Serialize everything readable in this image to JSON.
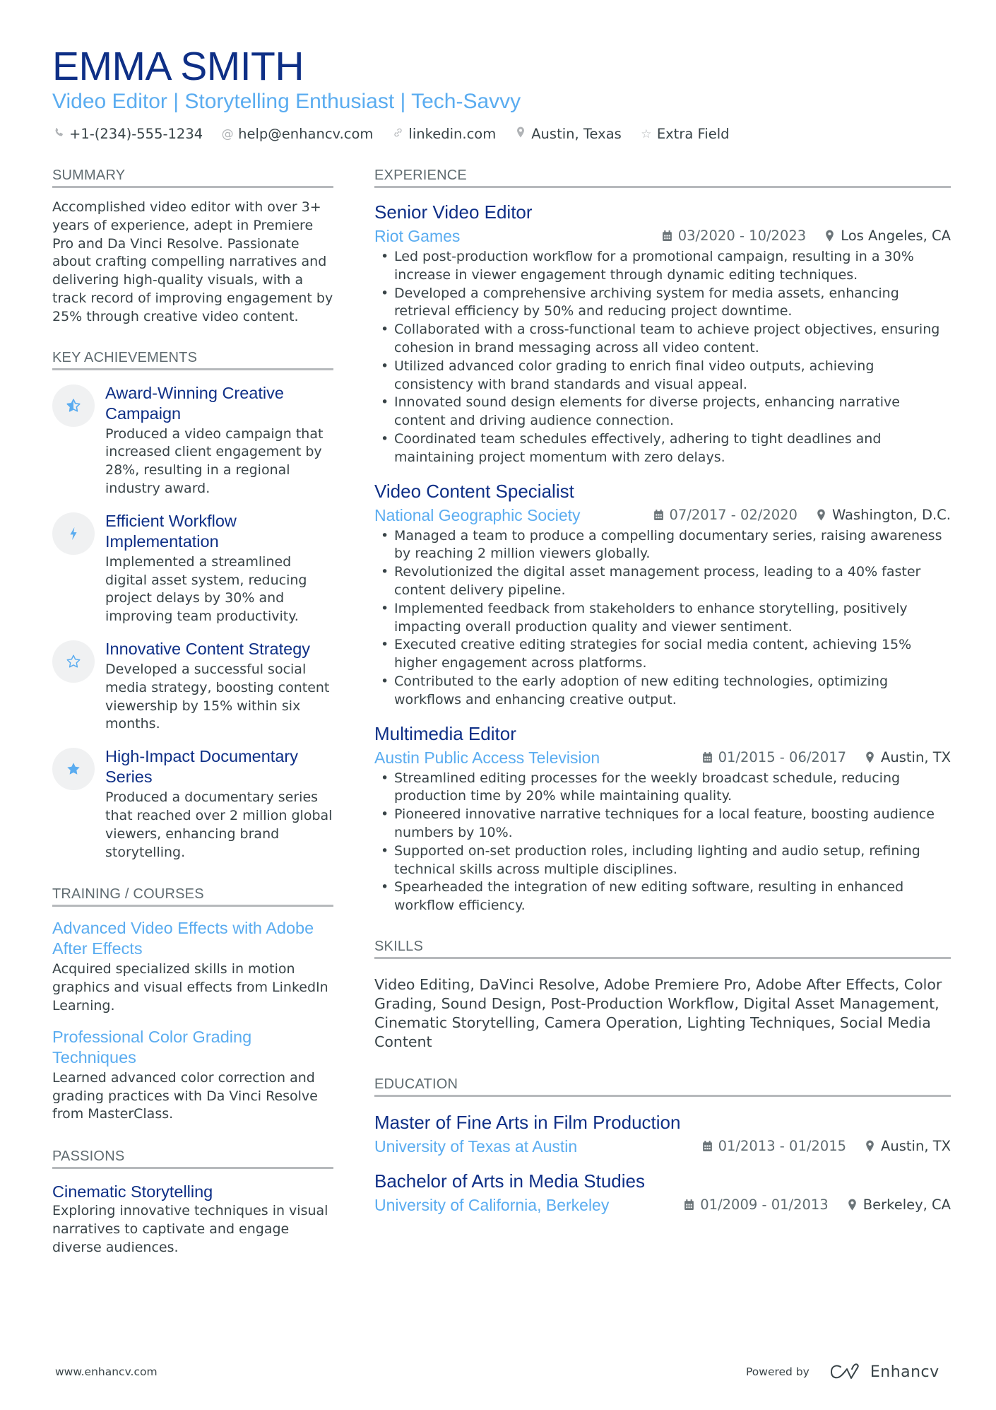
{
  "header": {
    "name": "EMMA SMITH",
    "subtitle": "Video Editor | Storytelling Enthusiast | Tech-Savvy",
    "contacts": [
      {
        "icon": "phone-icon",
        "text": "+1-(234)-555-1234"
      },
      {
        "icon": "at-icon",
        "text": "help@enhancv.com"
      },
      {
        "icon": "link-icon",
        "text": "linkedin.com"
      },
      {
        "icon": "location-icon",
        "text": "Austin, Texas"
      },
      {
        "icon": "star-icon",
        "text": "Extra Field"
      }
    ]
  },
  "colors": {
    "name": "#0e2f86",
    "accent": "#5aacf0",
    "text": "#384347",
    "section_rule": "#b6b9bc"
  },
  "summary": {
    "title": "SUMMARY",
    "text": "Accomplished video editor with over 3+ years of experience, adept in Premiere Pro and Da Vinci Resolve. Passionate about crafting compelling narratives and delivering high-quality visuals, with a track record of improving engagement by 25% through creative video content."
  },
  "achievements": {
    "title": "KEY ACHIEVEMENTS",
    "items": [
      {
        "icon": "star-half-icon",
        "title": "Award-Winning Creative Campaign",
        "desc": "Produced a video campaign that increased client engagement by 28%, resulting in a regional industry award."
      },
      {
        "icon": "lightning-icon",
        "title": "Efficient Workflow Implementation",
        "desc": "Implemented a streamlined digital asset system, reducing project delays by 30% and improving team productivity."
      },
      {
        "icon": "star-outline-icon",
        "title": "Innovative Content Strategy",
        "desc": "Developed a successful social media strategy, boosting content viewership by 15% within six months."
      },
      {
        "icon": "star-filled-icon",
        "title": "High-Impact Documentary Series",
        "desc": "Produced a documentary series that reached over 2 million global viewers, enhancing brand storytelling."
      }
    ]
  },
  "training": {
    "title": "TRAINING / COURSES",
    "items": [
      {
        "title": "Advanced Video Effects with Adobe After Effects",
        "desc": "Acquired specialized skills in motion graphics and visual effects from LinkedIn Learning."
      },
      {
        "title": "Professional Color Grading Techniques",
        "desc": "Learned advanced color correction and grading practices with Da Vinci Resolve from MasterClass."
      }
    ]
  },
  "passions": {
    "title": "PASSIONS",
    "items": [
      {
        "title": "Cinematic Storytelling",
        "desc": "Exploring innovative techniques in visual narratives to captivate and engage diverse audiences."
      }
    ]
  },
  "experience": {
    "title": "EXPERIENCE",
    "jobs": [
      {
        "title": "Senior Video Editor",
        "company": "Riot Games",
        "dates": "03/2020 - 10/2023",
        "location": "Los Angeles, CA",
        "bullets": [
          "Led post-production workflow for a promotional campaign, resulting in a 30% increase in viewer engagement through dynamic editing techniques.",
          "Developed a comprehensive archiving system for media assets, enhancing retrieval efficiency by 50% and reducing project downtime.",
          "Collaborated with a cross-functional team to achieve project objectives, ensuring cohesion in brand messaging across all video content.",
          "Utilized advanced color grading to enrich final video outputs, achieving consistency with brand standards and visual appeal.",
          "Innovated sound design elements for diverse projects, enhancing narrative content and driving audience connection.",
          "Coordinated team schedules effectively, adhering to tight deadlines and maintaining project momentum with zero delays."
        ]
      },
      {
        "title": "Video Content Specialist",
        "company": "National Geographic Society",
        "dates": "07/2017 - 02/2020",
        "location": "Washington, D.C.",
        "bullets": [
          "Managed a team to produce a compelling documentary series, raising awareness by reaching 2 million viewers globally.",
          "Revolutionized the digital asset management process, leading to a 40% faster content delivery pipeline.",
          "Implemented feedback from stakeholders to enhance storytelling, positively impacting overall production quality and viewer sentiment.",
          "Executed creative editing strategies for social media content, achieving 15% higher engagement across platforms.",
          "Contributed to the early adoption of new editing technologies, optimizing workflows and enhancing creative output."
        ]
      },
      {
        "title": "Multimedia Editor",
        "company": "Austin Public Access Television",
        "dates": "01/2015 - 06/2017",
        "location": "Austin, TX",
        "bullets": [
          "Streamlined editing processes for the weekly broadcast schedule, reducing production time by 20% while maintaining quality.",
          "Pioneered innovative narrative techniques for a local feature, boosting audience numbers by 10%.",
          "Supported on-set production roles, including lighting and audio setup, refining technical skills across multiple disciplines.",
          "Spearheaded the integration of new editing software, resulting in enhanced workflow efficiency."
        ]
      }
    ]
  },
  "skills": {
    "title": "SKILLS",
    "text": "Video Editing, DaVinci Resolve, Adobe Premiere Pro, Adobe After Effects, Color Grading, Sound Design, Post-Production Workflow, Digital Asset Management, Cinematic Storytelling, Camera Operation, Lighting Techniques, Social Media Content"
  },
  "education": {
    "title": "EDUCATION",
    "items": [
      {
        "degree": "Master of Fine Arts in Film Production",
        "school": "University of Texas at Austin",
        "dates": "01/2013 - 01/2015",
        "location": "Austin, TX"
      },
      {
        "degree": "Bachelor of Arts in Media Studies",
        "school": "University of California, Berkeley",
        "dates": "01/2009 - 01/2013",
        "location": "Berkeley, CA"
      }
    ]
  },
  "footer": {
    "website": "www.enhancv.com",
    "powered_by": "Powered by",
    "brand": "Enhancv"
  }
}
